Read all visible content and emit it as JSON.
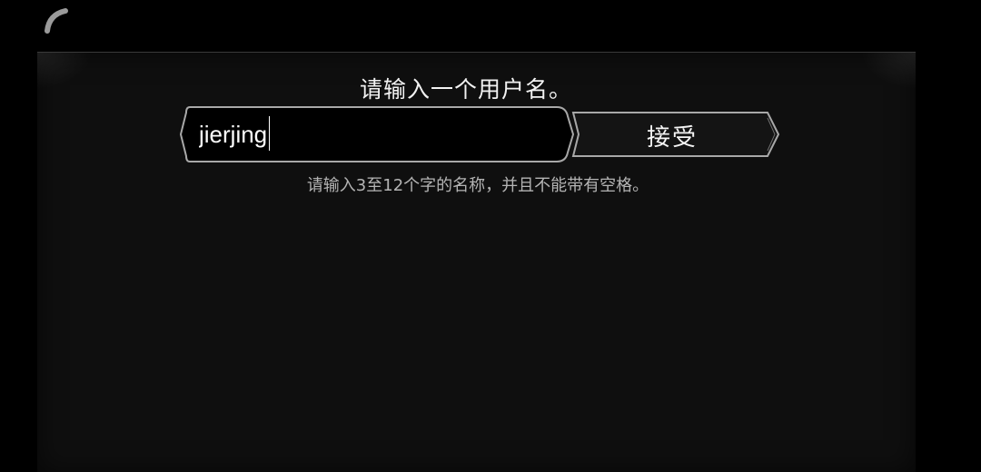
{
  "dialog": {
    "title": "请输入一个用户名。",
    "hint": "请输入3至12个字的名称，并且不能带有空格。"
  },
  "username_field": {
    "value": "jierjing",
    "placeholder": ""
  },
  "accept_button": {
    "label": "接受"
  },
  "icons": {
    "spinner": "loading-spinner-icon"
  },
  "colors": {
    "background": "#000000",
    "panel": "#0f0f0f",
    "frame_border": "#a8a8a8",
    "text_primary": "#f2f2f2",
    "text_hint": "#b4b4b4"
  }
}
